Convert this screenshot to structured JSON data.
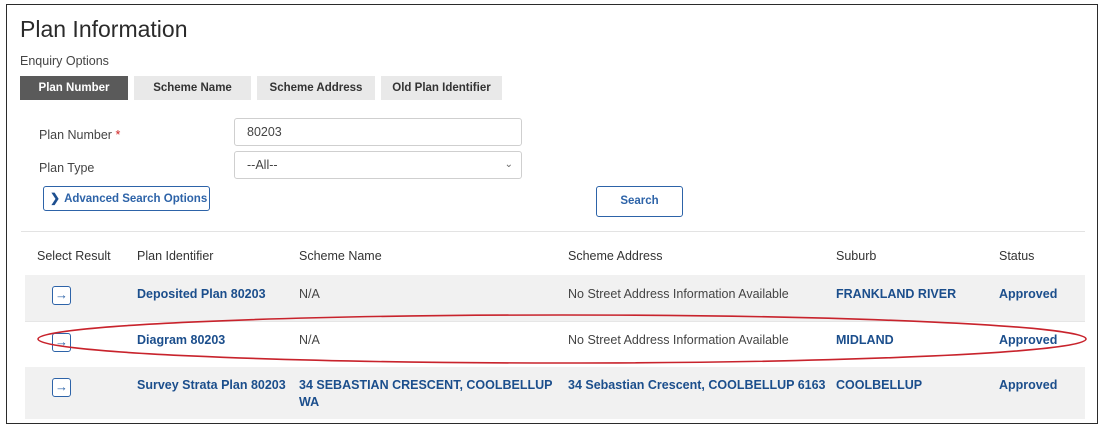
{
  "page": {
    "title": "Plan Information",
    "enquiry_label": "Enquiry Options"
  },
  "tabs": [
    {
      "label": "Plan Number",
      "active": true
    },
    {
      "label": "Scheme Name",
      "active": false
    },
    {
      "label": "Scheme Address",
      "active": false
    },
    {
      "label": "Old Plan Identifier",
      "active": false
    }
  ],
  "form": {
    "plan_number_label": "Plan Number",
    "required_marker": "*",
    "plan_number_value": "80203",
    "plan_type_label": "Plan Type",
    "plan_type_value": "--All--",
    "advanced_label": "Advanced Search Options",
    "search_label": "Search"
  },
  "table": {
    "headers": [
      "Select Result",
      "Plan Identifier",
      "Scheme Name",
      "Scheme Address",
      "Suburb",
      "Status"
    ],
    "rows": [
      {
        "plan": "Deposited Plan 80203",
        "scheme": "N/A",
        "address": "No Street Address Information Available",
        "suburb": "FRANKLAND RIVER",
        "status": "Approved"
      },
      {
        "plan": "Diagram 80203",
        "scheme": "N/A",
        "address": "No Street Address Information Available",
        "suburb": "MIDLAND",
        "status": "Approved"
      },
      {
        "plan": "Survey Strata Plan 80203",
        "scheme_line1": "34 SEBASTIAN CRESCENT, COOLBELLUP",
        "scheme_line2": "WA",
        "address": "34 Sebastian Crescent, COOLBELLUP 6163",
        "suburb": "COOLBELLUP",
        "status": "Approved"
      }
    ]
  },
  "colors": {
    "link": "#1b4e8c",
    "active_tab": "#5a5a5a",
    "annotation": "#c8232c"
  },
  "icons": {
    "row_select": "arrow-right-icon",
    "advanced": "chevron-right-icon",
    "dropdown": "chevron-down-icon"
  }
}
